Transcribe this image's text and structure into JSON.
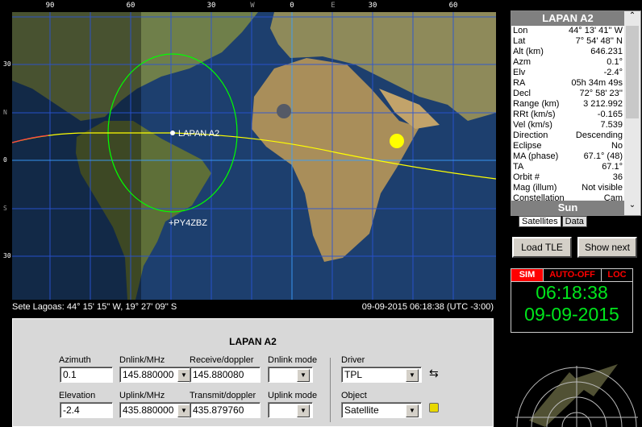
{
  "map": {
    "top_labels": [
      "90",
      "60",
      "30",
      "W",
      "0",
      "E",
      "30",
      "60"
    ],
    "side_labels": [
      "30",
      "N",
      "0",
      "S",
      "30"
    ],
    "satellite_label": "LAPAN A2",
    "station_label": "+PY4ZBZ",
    "status_location": "Sete Lagoas: 44° 15' 15'' W, 19° 27' 09'' S",
    "status_time": "09-09-2015 06:18:38 (UTC -3:00)",
    "colors": {
      "track": "#ffff00",
      "footprint": "#00ff00",
      "sun": "#ffff00"
    }
  },
  "info": {
    "title": "LAPAN A2",
    "rows": [
      [
        "Lon",
        "44° 13' 41'' W"
      ],
      [
        "Lat",
        "7° 54' 48'' N"
      ],
      [
        "Alt (km)",
        "646.231"
      ],
      [
        "Azm",
        "0.1°"
      ],
      [
        "Elv",
        "-2.4°"
      ],
      [
        "RA",
        "05h 34m 49s"
      ],
      [
        "Decl",
        "72° 58' 23''"
      ],
      [
        "Range (km)",
        "3 212.992"
      ],
      [
        "RRt (km/s)",
        "-0.165"
      ],
      [
        "Vel (km/s)",
        "7.539"
      ],
      [
        "Direction",
        "Descending"
      ],
      [
        "Eclipse",
        "No"
      ],
      [
        "MA (phase)",
        "67.1° (48)"
      ],
      [
        "TA",
        "67.1°"
      ],
      [
        "Orbit #",
        "36"
      ],
      [
        "Mag (illum)",
        "Not visible"
      ],
      [
        "Constellation",
        "Cam"
      ]
    ],
    "footer": "Sun",
    "tabs": [
      "Satellites",
      "Data"
    ]
  },
  "buttons": {
    "load_tle": "Load TLE",
    "show_next": "Show next"
  },
  "clock": {
    "sim": "SIM",
    "auto": "AUTO-OFF",
    "loc": "LOC",
    "time": "06:18:38",
    "date": "09-09-2015"
  },
  "panel": {
    "title": "LAPAN A2",
    "azimuth_label": "Azimuth",
    "azimuth": "0.1",
    "elevation_label": "Elevation",
    "elevation": "-2.4",
    "dnlink_label": "Dnlink/MHz",
    "dnlink": "145.880000",
    "uplink_label": "Uplink/MHz",
    "uplink": "435.880000",
    "receive_label": "Receive/doppler",
    "receive": "145.880080",
    "transmit_label": "Transmit/doppler",
    "transmit": "435.879760",
    "dnmode_label": "Dnlink mode",
    "dnmode": "",
    "upmode_label": "Uplink mode",
    "upmode": "",
    "driver_label": "Driver",
    "driver": "TPL",
    "object_label": "Object",
    "object": "Satellite"
  }
}
